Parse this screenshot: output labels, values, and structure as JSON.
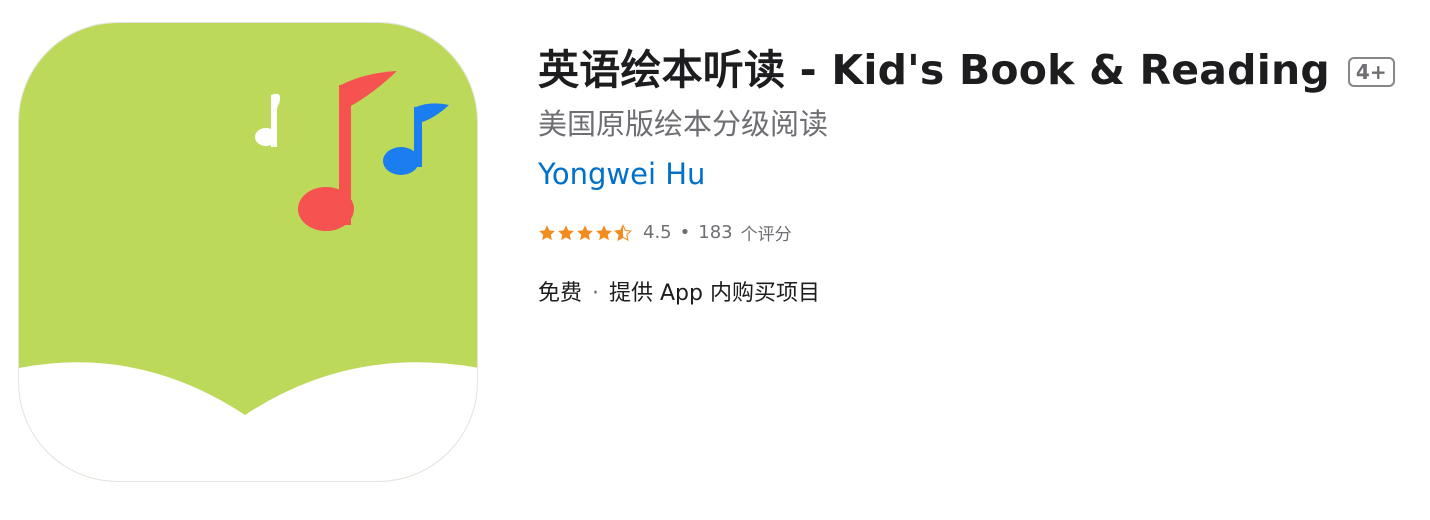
{
  "app": {
    "title": "英语绘本听读 - Kid's Book & Reading",
    "age_rating": "4+",
    "subtitle": "美国原版绘本分级阅读",
    "developer": "Yongwei Hu",
    "rating": {
      "stars": 4.5,
      "value": "4.5",
      "dot": "•",
      "count": "183",
      "count_unit": "个评分"
    },
    "price": "免费",
    "price_separator": "·",
    "in_app": "提供 App 内购买项目"
  },
  "colors": {
    "icon_green": "#bcd95a",
    "note_white": "#ffffff",
    "note_red": "#f65250",
    "note_blue": "#1a7ef0",
    "star": "#f28c1e",
    "link": "#0070c9"
  },
  "icons": {
    "app_icon": "music-notes-book-icon",
    "star": "star-icon"
  }
}
